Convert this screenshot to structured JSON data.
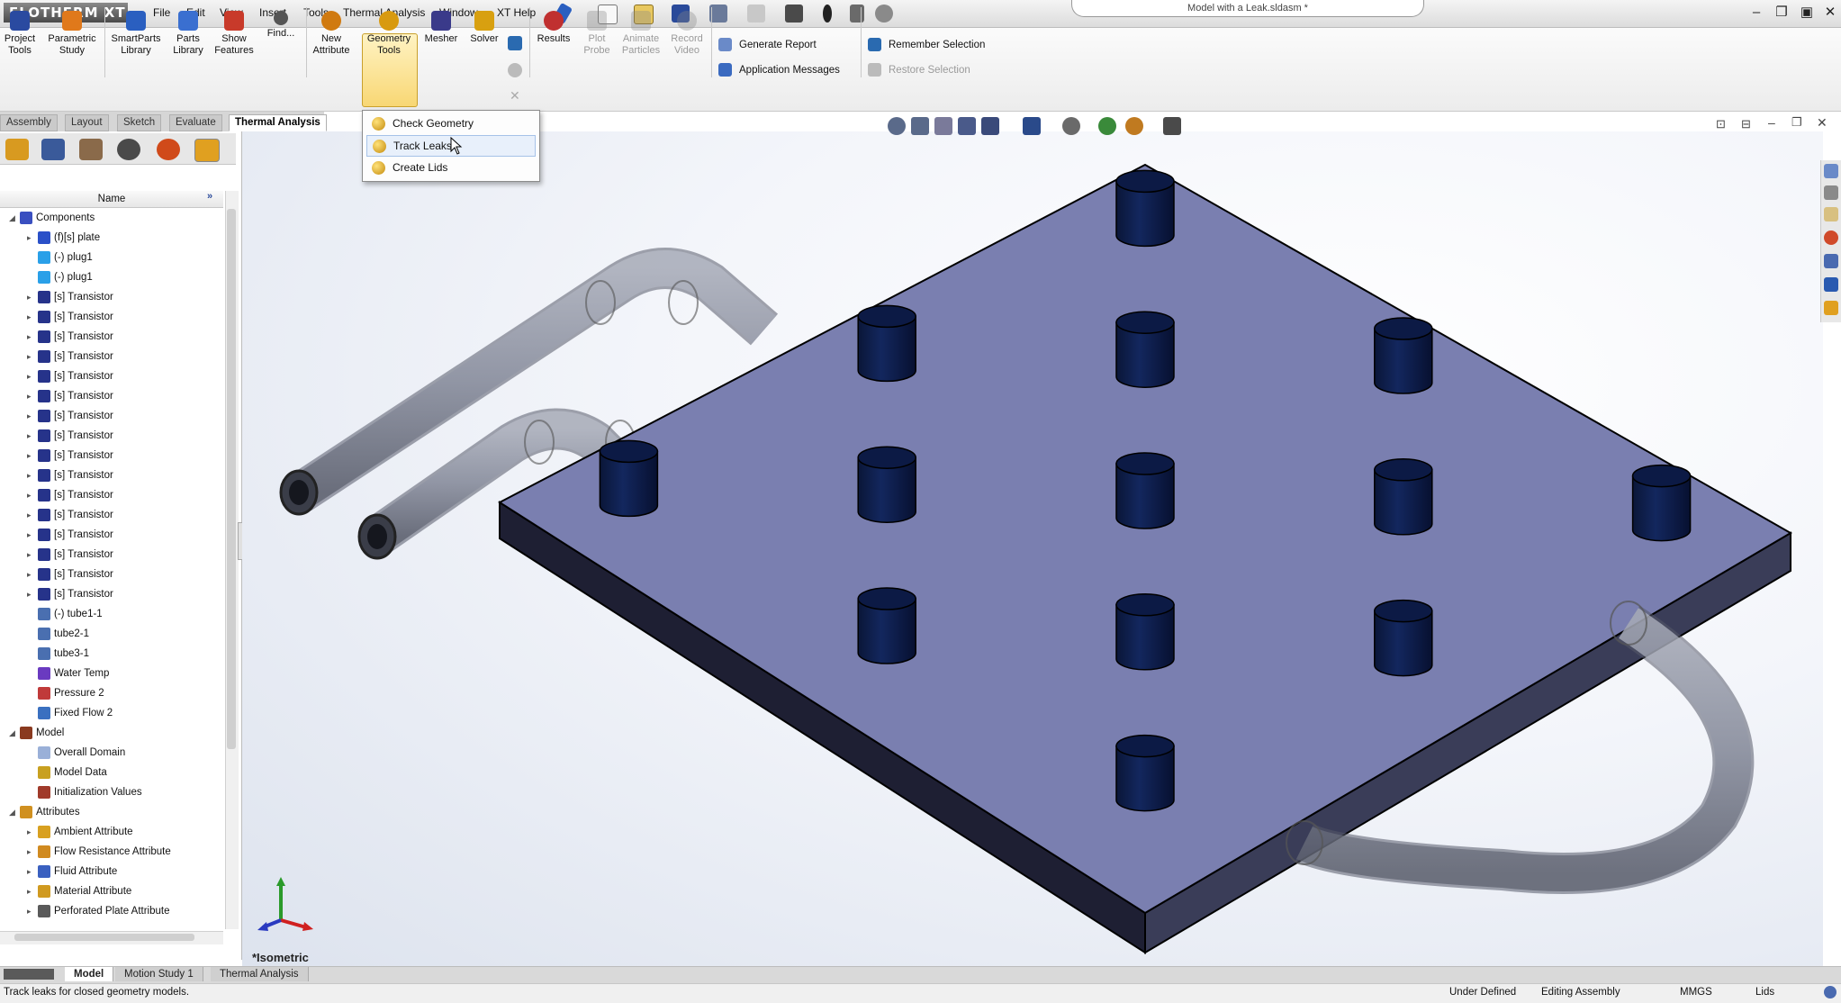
{
  "app": {
    "logo_text": "FLOTHERM XT",
    "document_title": "Model with a Leak.sldasm *"
  },
  "menu": [
    "File",
    "Edit",
    "View",
    "Insert",
    "Tools",
    "Thermal Analysis",
    "Window",
    "XT Help"
  ],
  "ribbon": {
    "buttons": [
      {
        "label": "Project\nTools",
        "icon": "project-tools-icon",
        "color": "#2a4aa0"
      },
      {
        "label": "Parametric\nStudy",
        "icon": "parametric-study-icon",
        "color": "#e0791b"
      },
      {
        "label": "SmartParts\nLibrary",
        "icon": "smartparts-library-icon",
        "color": "#2a5fc0"
      },
      {
        "label": "Parts\nLibrary",
        "icon": "parts-library-icon",
        "color": "#3a6fd0"
      },
      {
        "label": "Show\nFeatures",
        "icon": "show-features-icon",
        "color": "#c83a2a"
      },
      {
        "label": "Find...",
        "icon": "find-icon",
        "color": "#555555"
      },
      {
        "label": "New\nAttribute",
        "icon": "new-attribute-icon",
        "color": "#d07a10"
      },
      {
        "label": "Geometry\nTools",
        "icon": "geometry-tools-icon",
        "color": "#d89a10"
      },
      {
        "label": "Mesher",
        "icon": "mesher-icon",
        "color": "#3a3a8a"
      },
      {
        "label": "Solver",
        "icon": "solver-icon",
        "color": "#d8a010"
      },
      {
        "label": "Results",
        "icon": "results-icon",
        "color": "#c03030"
      },
      {
        "label": "Plot\nProbe",
        "icon": "plot-probe-icon",
        "color": "#888888",
        "disabled": true
      },
      {
        "label": "Animate\nParticles",
        "icon": "animate-particles-icon",
        "color": "#888888",
        "disabled": true
      },
      {
        "label": "Record\nVideo",
        "icon": "record-video-icon",
        "color": "#888888",
        "disabled": true
      }
    ],
    "small_buttons": [
      {
        "label": "Generate Report",
        "icon": "generate-report-icon"
      },
      {
        "label": "Application Messages",
        "icon": "application-messages-icon"
      },
      {
        "label": "Remember Selection",
        "icon": "remember-selection-icon"
      },
      {
        "label": "Restore Selection",
        "icon": "restore-selection-icon",
        "disabled": true
      }
    ]
  },
  "tabs": [
    {
      "label": "Assembly"
    },
    {
      "label": "Layout"
    },
    {
      "label": "Sketch"
    },
    {
      "label": "Evaluate"
    },
    {
      "label": "Thermal Analysis",
      "active": true
    }
  ],
  "dropdown": {
    "items": [
      {
        "label": "Check Geometry"
      },
      {
        "label": "Track Leaks",
        "hover": true
      },
      {
        "label": "Create Lids"
      }
    ]
  },
  "tree": {
    "header": "Name",
    "rows": [
      {
        "label": "Components",
        "depth": 0,
        "icon_color": "#3a4fc0",
        "expand": "open"
      },
      {
        "label": "(f)[s] plate",
        "depth": 1,
        "icon_color": "#2a50c8",
        "expand": "closed"
      },
      {
        "label": "(-) plug1",
        "depth": 1,
        "icon_color": "#2aa0e8",
        "expand": "none"
      },
      {
        "label": "(-) plug1",
        "depth": 1,
        "icon_color": "#2aa0e8",
        "expand": "none"
      },
      {
        "label": "[s] Transistor",
        "depth": 1,
        "icon_color": "#26338a",
        "expand": "closed"
      },
      {
        "label": "[s] Transistor",
        "depth": 1,
        "icon_color": "#26338a",
        "expand": "closed"
      },
      {
        "label": "[s] Transistor",
        "depth": 1,
        "icon_color": "#26338a",
        "expand": "closed"
      },
      {
        "label": "[s] Transistor",
        "depth": 1,
        "icon_color": "#26338a",
        "expand": "closed"
      },
      {
        "label": "[s] Transistor",
        "depth": 1,
        "icon_color": "#26338a",
        "expand": "closed"
      },
      {
        "label": "[s] Transistor",
        "depth": 1,
        "icon_color": "#26338a",
        "expand": "closed"
      },
      {
        "label": "[s] Transistor",
        "depth": 1,
        "icon_color": "#26338a",
        "expand": "closed"
      },
      {
        "label": "[s] Transistor",
        "depth": 1,
        "icon_color": "#26338a",
        "expand": "closed"
      },
      {
        "label": "[s] Transistor",
        "depth": 1,
        "icon_color": "#26338a",
        "expand": "closed"
      },
      {
        "label": "[s] Transistor",
        "depth": 1,
        "icon_color": "#26338a",
        "expand": "closed"
      },
      {
        "label": "[s] Transistor",
        "depth": 1,
        "icon_color": "#26338a",
        "expand": "closed"
      },
      {
        "label": "[s] Transistor",
        "depth": 1,
        "icon_color": "#26338a",
        "expand": "closed"
      },
      {
        "label": "[s] Transistor",
        "depth": 1,
        "icon_color": "#26338a",
        "expand": "closed"
      },
      {
        "label": "[s] Transistor",
        "depth": 1,
        "icon_color": "#26338a",
        "expand": "closed"
      },
      {
        "label": "[s] Transistor",
        "depth": 1,
        "icon_color": "#26338a",
        "expand": "closed"
      },
      {
        "label": "[s] Transistor",
        "depth": 1,
        "icon_color": "#26338a",
        "expand": "closed"
      },
      {
        "label": "(-) tube1-1",
        "depth": 1,
        "icon_color": "#4a6fb0",
        "expand": "none"
      },
      {
        "label": "tube2-1",
        "depth": 1,
        "icon_color": "#4a6fb0",
        "expand": "none"
      },
      {
        "label": "tube3-1",
        "depth": 1,
        "icon_color": "#4a6fb0",
        "expand": "none"
      },
      {
        "label": "Water Temp",
        "depth": 1,
        "icon_color": "#6a3ac0",
        "expand": "none"
      },
      {
        "label": "Pressure 2",
        "depth": 1,
        "icon_color": "#c03a3a",
        "expand": "none"
      },
      {
        "label": "Fixed Flow 2",
        "depth": 1,
        "icon_color": "#3a70c0",
        "expand": "none"
      },
      {
        "label": "Model",
        "depth": 0,
        "icon_color": "#8a3a20",
        "expand": "open"
      },
      {
        "label": "Overall Domain",
        "depth": 1,
        "icon_color": "#9ab0d8",
        "expand": "none"
      },
      {
        "label": "Model Data",
        "depth": 1,
        "icon_color": "#c8a020",
        "expand": "none"
      },
      {
        "label": "Initialization Values",
        "depth": 1,
        "icon_color": "#a03a2a",
        "expand": "none"
      },
      {
        "label": "Attributes",
        "depth": 0,
        "icon_color": "#d09020",
        "expand": "open"
      },
      {
        "label": "Ambient Attribute",
        "depth": 1,
        "icon_color": "#d8a020",
        "expand": "closed"
      },
      {
        "label": "Flow Resistance Attribute",
        "depth": 1,
        "icon_color": "#d08a20",
        "expand": "closed"
      },
      {
        "label": "Fluid Attribute",
        "depth": 1,
        "icon_color": "#3a60c0",
        "expand": "closed"
      },
      {
        "label": "Material Attribute",
        "depth": 1,
        "icon_color": "#d09a20",
        "expand": "closed"
      },
      {
        "label": "Perforated Plate Attribute",
        "depth": 1,
        "icon_color": "#5a5a5a",
        "expand": "closed"
      }
    ]
  },
  "viewport": {
    "view_label": "*Isometric",
    "plate_top_color": "#7a7fb0",
    "plate_side_left": "#1e1f33",
    "plate_side_right": "#3a3d58",
    "transistor_color": "#0c1a45"
  },
  "bottom_tabs": [
    {
      "label": "Model",
      "active": true
    },
    {
      "label": "Motion Study 1"
    },
    {
      "label": "Thermal Analysis"
    }
  ],
  "status": {
    "message": "Track leaks for closed geometry models.",
    "state": "Under Defined",
    "mode": "Editing Assembly",
    "units": "MMGS",
    "lids": "Lids"
  }
}
